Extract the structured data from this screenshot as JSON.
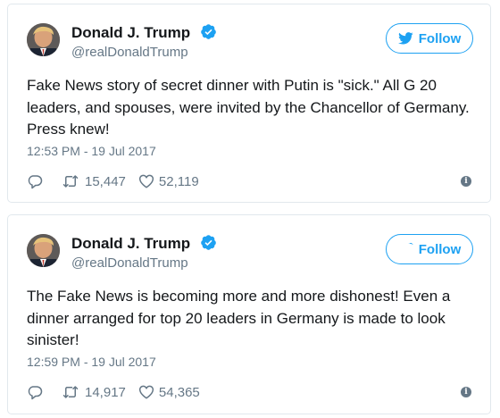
{
  "tweets": [
    {
      "name": "Donald J. Trump",
      "handle": "@realDonaldTrump",
      "follow_label": "Follow",
      "text": "Fake News story of secret dinner with Putin is \"sick.\" All G 20 leaders, and spouses, were invited by the Chancellor of Germany. Press knew!",
      "timestamp": "12:53 PM - 19 Jul 2017",
      "retweets": "15,447",
      "likes": "52,119"
    },
    {
      "name": "Donald J. Trump",
      "handle": "@realDonaldTrump",
      "follow_label": "Follow",
      "text": "The Fake News is becoming more and more dishonest! Even a dinner arranged for top 20 leaders in Germany is made to look sinister!",
      "timestamp": "12:59 PM - 19 Jul 2017",
      "retweets": "14,917",
      "likes": "54,365"
    }
  ],
  "icons": {
    "verified": "verified-badge-icon",
    "follow": "twitter-bird-icon",
    "reply": "reply-icon",
    "retweet": "retweet-icon",
    "like": "heart-icon",
    "info": "info-icon"
  },
  "colors": {
    "accent": "#1da1f2",
    "secondary_text": "#657786",
    "border": "#e1e8ed"
  }
}
